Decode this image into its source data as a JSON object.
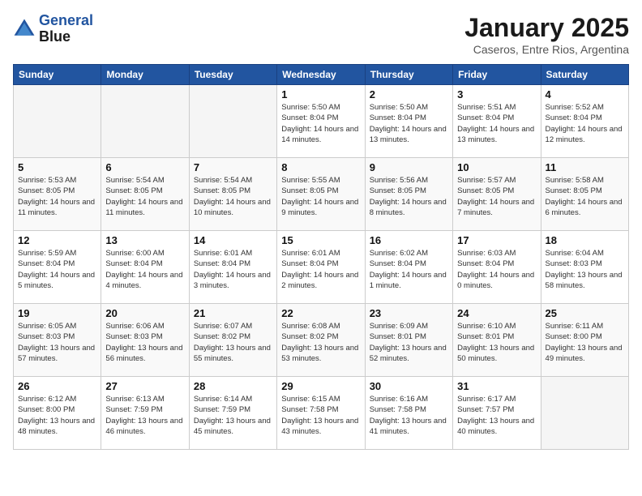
{
  "header": {
    "logo_line1": "General",
    "logo_line2": "Blue",
    "month": "January 2025",
    "location": "Caseros, Entre Rios, Argentina"
  },
  "weekdays": [
    "Sunday",
    "Monday",
    "Tuesday",
    "Wednesday",
    "Thursday",
    "Friday",
    "Saturday"
  ],
  "weeks": [
    [
      {
        "day": "",
        "info": ""
      },
      {
        "day": "",
        "info": ""
      },
      {
        "day": "",
        "info": ""
      },
      {
        "day": "1",
        "info": "Sunrise: 5:50 AM\nSunset: 8:04 PM\nDaylight: 14 hours\nand 14 minutes."
      },
      {
        "day": "2",
        "info": "Sunrise: 5:50 AM\nSunset: 8:04 PM\nDaylight: 14 hours\nand 13 minutes."
      },
      {
        "day": "3",
        "info": "Sunrise: 5:51 AM\nSunset: 8:04 PM\nDaylight: 14 hours\nand 13 minutes."
      },
      {
        "day": "4",
        "info": "Sunrise: 5:52 AM\nSunset: 8:04 PM\nDaylight: 14 hours\nand 12 minutes."
      }
    ],
    [
      {
        "day": "5",
        "info": "Sunrise: 5:53 AM\nSunset: 8:05 PM\nDaylight: 14 hours\nand 11 minutes."
      },
      {
        "day": "6",
        "info": "Sunrise: 5:54 AM\nSunset: 8:05 PM\nDaylight: 14 hours\nand 11 minutes."
      },
      {
        "day": "7",
        "info": "Sunrise: 5:54 AM\nSunset: 8:05 PM\nDaylight: 14 hours\nand 10 minutes."
      },
      {
        "day": "8",
        "info": "Sunrise: 5:55 AM\nSunset: 8:05 PM\nDaylight: 14 hours\nand 9 minutes."
      },
      {
        "day": "9",
        "info": "Sunrise: 5:56 AM\nSunset: 8:05 PM\nDaylight: 14 hours\nand 8 minutes."
      },
      {
        "day": "10",
        "info": "Sunrise: 5:57 AM\nSunset: 8:05 PM\nDaylight: 14 hours\nand 7 minutes."
      },
      {
        "day": "11",
        "info": "Sunrise: 5:58 AM\nSunset: 8:05 PM\nDaylight: 14 hours\nand 6 minutes."
      }
    ],
    [
      {
        "day": "12",
        "info": "Sunrise: 5:59 AM\nSunset: 8:04 PM\nDaylight: 14 hours\nand 5 minutes."
      },
      {
        "day": "13",
        "info": "Sunrise: 6:00 AM\nSunset: 8:04 PM\nDaylight: 14 hours\nand 4 minutes."
      },
      {
        "day": "14",
        "info": "Sunrise: 6:01 AM\nSunset: 8:04 PM\nDaylight: 14 hours\nand 3 minutes."
      },
      {
        "day": "15",
        "info": "Sunrise: 6:01 AM\nSunset: 8:04 PM\nDaylight: 14 hours\nand 2 minutes."
      },
      {
        "day": "16",
        "info": "Sunrise: 6:02 AM\nSunset: 8:04 PM\nDaylight: 14 hours\nand 1 minute."
      },
      {
        "day": "17",
        "info": "Sunrise: 6:03 AM\nSunset: 8:04 PM\nDaylight: 14 hours\nand 0 minutes."
      },
      {
        "day": "18",
        "info": "Sunrise: 6:04 AM\nSunset: 8:03 PM\nDaylight: 13 hours\nand 58 minutes."
      }
    ],
    [
      {
        "day": "19",
        "info": "Sunrise: 6:05 AM\nSunset: 8:03 PM\nDaylight: 13 hours\nand 57 minutes."
      },
      {
        "day": "20",
        "info": "Sunrise: 6:06 AM\nSunset: 8:03 PM\nDaylight: 13 hours\nand 56 minutes."
      },
      {
        "day": "21",
        "info": "Sunrise: 6:07 AM\nSunset: 8:02 PM\nDaylight: 13 hours\nand 55 minutes."
      },
      {
        "day": "22",
        "info": "Sunrise: 6:08 AM\nSunset: 8:02 PM\nDaylight: 13 hours\nand 53 minutes."
      },
      {
        "day": "23",
        "info": "Sunrise: 6:09 AM\nSunset: 8:01 PM\nDaylight: 13 hours\nand 52 minutes."
      },
      {
        "day": "24",
        "info": "Sunrise: 6:10 AM\nSunset: 8:01 PM\nDaylight: 13 hours\nand 50 minutes."
      },
      {
        "day": "25",
        "info": "Sunrise: 6:11 AM\nSunset: 8:00 PM\nDaylight: 13 hours\nand 49 minutes."
      }
    ],
    [
      {
        "day": "26",
        "info": "Sunrise: 6:12 AM\nSunset: 8:00 PM\nDaylight: 13 hours\nand 48 minutes."
      },
      {
        "day": "27",
        "info": "Sunrise: 6:13 AM\nSunset: 7:59 PM\nDaylight: 13 hours\nand 46 minutes."
      },
      {
        "day": "28",
        "info": "Sunrise: 6:14 AM\nSunset: 7:59 PM\nDaylight: 13 hours\nand 45 minutes."
      },
      {
        "day": "29",
        "info": "Sunrise: 6:15 AM\nSunset: 7:58 PM\nDaylight: 13 hours\nand 43 minutes."
      },
      {
        "day": "30",
        "info": "Sunrise: 6:16 AM\nSunset: 7:58 PM\nDaylight: 13 hours\nand 41 minutes."
      },
      {
        "day": "31",
        "info": "Sunrise: 6:17 AM\nSunset: 7:57 PM\nDaylight: 13 hours\nand 40 minutes."
      },
      {
        "day": "",
        "info": ""
      }
    ]
  ]
}
